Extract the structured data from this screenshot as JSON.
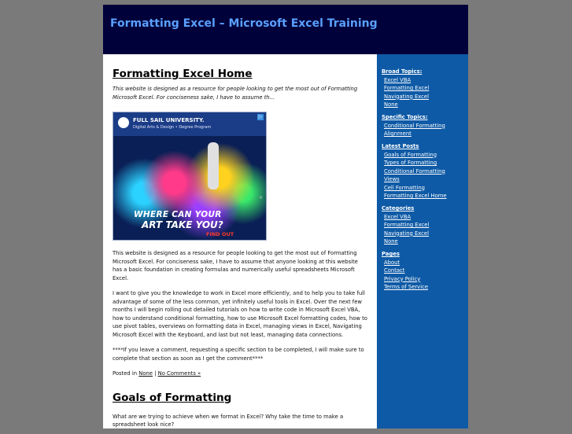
{
  "header": {
    "site_title": "Formatting Excel – Microsoft Excel Training"
  },
  "post1": {
    "title": "Formatting Excel Home",
    "excerpt": "This website is designed as a resource for people looking to get the most out of Formatting Microsoft Excel. For conciseness sake, I have to assume th...",
    "paragraphs": [
      "This website is designed as a resource for people looking to get the most out of Formatting Microsoft Excel. For conciseness sake, I have to assume that anyone looking at this website has a basic foundation in creating formulas and numerically useful spreadsheets Microsoft Excel.",
      "I want to give you the knowledge to work in Excel more efficiently, and to help you to take full advantage of some of the less common, yet infinitely useful tools in Excel. Over the next few months I will begin rolling out detailed tutorials on how to write code in Microsoft Excel VBA, how to understand conditional formatting, how to use Microsoft Excel formatting codes, how to use pivot tables, overviews on formatting data in Excel, managing views in Excel, Navigating Microsoft Excel with the Keyboard, and last but not least, managing data connections.",
      "****If you leave a comment, requesting a specific section to be completed, I will make sure to complete that section as soon as I get the comment****"
    ],
    "posted_in_label": "Posted in",
    "category_link": "None",
    "separator": "|",
    "comments_link": "No Comments »"
  },
  "ad": {
    "brand": "FULL SAIL UNIVERSITY.",
    "subtitle": "Digital Arts & Design • Degree Program",
    "cta_line1": "WHERE CAN YOUR",
    "cta_line2": "ART TAKE YOU?",
    "find_out": "FIND OUT",
    "choices_glyph": "▷",
    "close_glyph": "×"
  },
  "post2": {
    "title": "Goals of Formatting",
    "text": "What are we trying to achieve when we format in Excel? Why take the time to make a spreadsheet look nice?"
  },
  "sidebar": {
    "broad": {
      "heading": "Broad Topics:",
      "items": [
        "Excel VBA",
        "Formatting Excel",
        "Navigating Excel",
        "None"
      ]
    },
    "specific": {
      "heading": "Specific Topics:",
      "items": [
        "Conditional Formatting",
        "Alignment"
      ]
    },
    "latest": {
      "heading": "Latest Posts",
      "items": [
        "Goals of Formatting",
        "Types of Formatting",
        "Conditional Formatting",
        "Views",
        "Cell Formatting",
        "Formatting Excel Home"
      ]
    },
    "categories": {
      "heading": "Categories",
      "items": [
        "Excel VBA",
        "Formatting Excel",
        "Navigating Excel",
        "None"
      ]
    },
    "pages": {
      "heading": "Pages",
      "items": [
        "About",
        "Contact",
        "Privacy Policy",
        "Terms of Service"
      ]
    }
  }
}
